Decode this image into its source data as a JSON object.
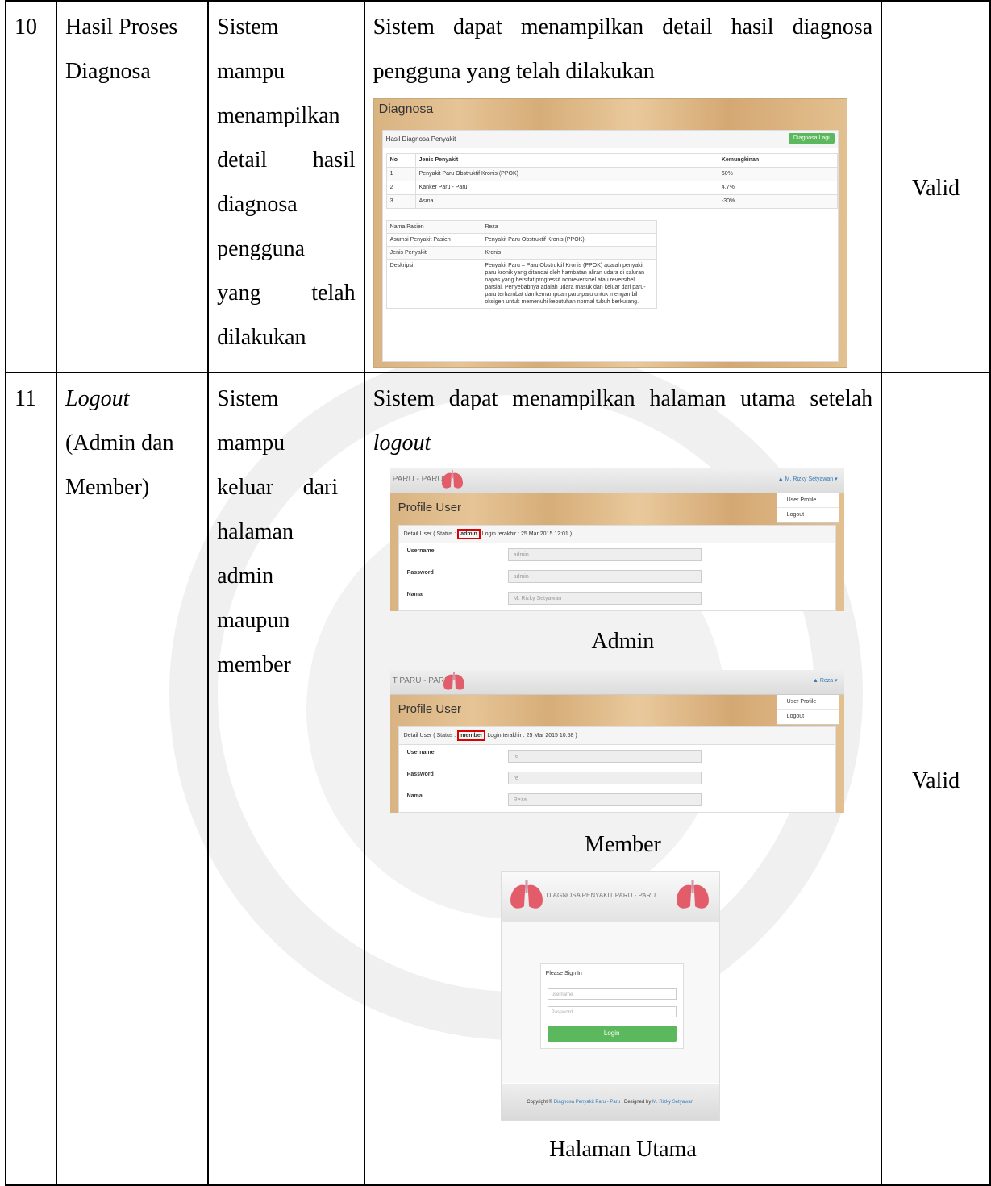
{
  "rows": [
    {
      "no": "10",
      "name_lines": [
        "Hasil Proses",
        "Diagnosa"
      ],
      "req_lines": [
        "Sistem",
        "mampu",
        "menampilkan",
        "detail hasil",
        "diagnosa",
        "pengguna",
        "yang telah",
        "dilakukan"
      ],
      "result_text": "Sistem dapat menampilkan detail hasil diagnosa pengguna yang telah dilakukan",
      "validity": "Valid"
    },
    {
      "no": "11",
      "name_italic": "Logout",
      "name_rest": "(Admin dan Member)",
      "req_text": "Sistem mampu keluar dari halaman admin maupun member",
      "result_prefix": "Sistem dapat menampilkan halaman utama setelah ",
      "result_italic": "logout",
      "validity": "Valid",
      "captions": {
        "admin": "Admin",
        "member": "Member",
        "home": "Halaman Utama"
      }
    }
  ],
  "diagnosa_shot": {
    "title": "Diagnosa",
    "panel_title": "Hasil Diagnosa Penyakit",
    "button": "Diagnosa Lagi",
    "headers": [
      "No",
      "Jenis Penyakit",
      "Kemungkinan"
    ],
    "results": [
      [
        "1",
        "Penyakit Paru Obstruktif Kronis (PPOK)",
        "60%"
      ],
      [
        "2",
        "Kanker Paru - Paru",
        "4.7%"
      ],
      [
        "3",
        "Asma",
        "-30%"
      ]
    ],
    "details": [
      [
        "Nama Pasien",
        "Reza"
      ],
      [
        "Asumsi Penyakit Pasien",
        "Penyakit Paru Obstruktif Kronis (PPOK)"
      ],
      [
        "Jenis Penyakit",
        "Kronis"
      ],
      [
        "Deskripsi",
        "Penyakit Paru – Paru Obstruktif Kronis (PPOK) adalah penyakit paru kronik yang ditandai oleh hambatan aliran udara di saluran napas yang bersifat progressif nonreversibel atau reversibel parsial. Penyebabnya adalah udara masuk dan keluar dari paru-paru terhambat dan kemampuan paru-paru untuk mengambil oksigen untuk memenuhi kebutuhan normal tubuh berkurang."
      ]
    ]
  },
  "admin_shot": {
    "brand": "PARU - PARU",
    "user": "M. Rizky Setyawan",
    "menu": [
      "User Profile",
      "Logout"
    ],
    "title": "Profile User",
    "detail_prefix": "Detail User ( Status :",
    "status": "admin",
    "detail_suffix": "Login terakhir : 25 Mar 2015 12:01 )",
    "fields": [
      [
        "Username",
        "admin"
      ],
      [
        "Password",
        "admin"
      ],
      [
        "Nama",
        "M. Rizky Setyawan"
      ]
    ]
  },
  "member_shot": {
    "brand": "T PARU - PARU",
    "user": "Reza",
    "menu": [
      "User Profile",
      "Logout"
    ],
    "title": "Profile User",
    "detail_prefix": "Detail User ( Status :",
    "status": "member",
    "detail_suffix": "Login terakhir : 25 Mar 2015 10:58 )",
    "fields": [
      [
        "Username",
        "re"
      ],
      [
        "Password",
        "re"
      ],
      [
        "Nama",
        "Reza"
      ]
    ]
  },
  "login_shot": {
    "brand": "DIAGNOSA PENYAKIT PARU - PARU",
    "panel_title": "Please Sign In",
    "username_placeholder": "username",
    "password_placeholder": "Password",
    "button": "Login",
    "footer_prefix": "Copyright © ",
    "footer_link1": "Diagnosa Penyakit Paru - Paru",
    "footer_mid": " | Designed by ",
    "footer_link2": "M. Rizky Setyawan"
  },
  "colors": {
    "green": "#5cb85c",
    "status_border": "#dd0000",
    "link": "#337ab7"
  }
}
